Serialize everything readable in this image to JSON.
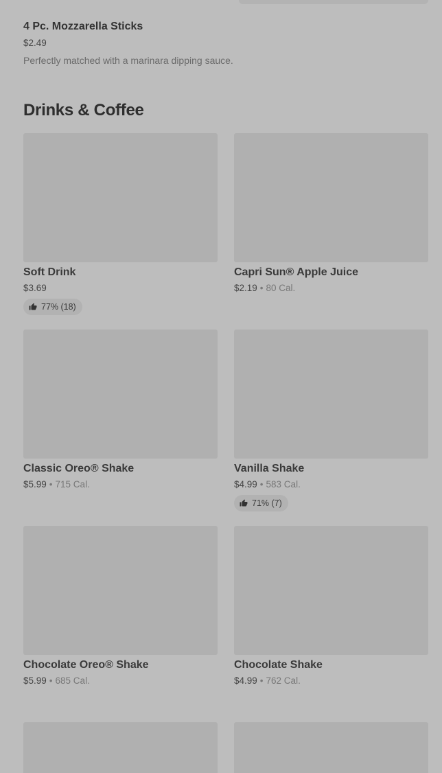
{
  "previous_section_item": {
    "name": "4 Pc. Mozzarella Sticks",
    "price": "$2.49",
    "description": "Perfectly matched with a marinara dipping sauce."
  },
  "section": {
    "title": "Drinks & Coffee"
  },
  "items": [
    {
      "name": "Soft Drink",
      "price": "$3.69",
      "calories": "",
      "rating": "77% (18)"
    },
    {
      "name": "Capri Sun® Apple Juice",
      "price": "$2.19",
      "calories": "80 Cal.",
      "rating": ""
    },
    {
      "name": "Classic Oreo® Shake",
      "price": "$5.99",
      "calories": "715 Cal.",
      "rating": ""
    },
    {
      "name": "Vanilla Shake",
      "price": "$4.99",
      "calories": "583 Cal.",
      "rating": "71% (7)"
    },
    {
      "name": "Chocolate Oreo® Shake",
      "price": "$5.99",
      "calories": "685 Cal.",
      "rating": ""
    },
    {
      "name": "Chocolate Shake",
      "price": "$4.99",
      "calories": "762 Cal.",
      "rating": ""
    }
  ],
  "icons": {
    "rating": "thumbs-up-icon"
  },
  "colors": {
    "background": "#bdbdbd",
    "image_placeholder": "#b0b0b0",
    "badge": "#b2b2b2"
  }
}
